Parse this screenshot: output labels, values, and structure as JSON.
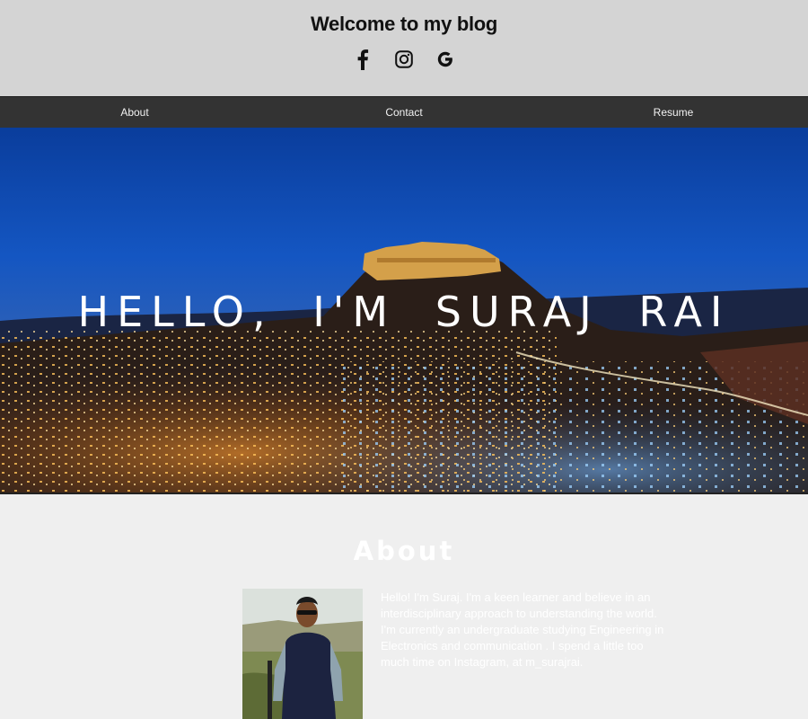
{
  "header": {
    "title": "Welcome to my blog",
    "social": [
      {
        "name": "facebook",
        "icon": "facebook-icon"
      },
      {
        "name": "instagram",
        "icon": "instagram-icon"
      },
      {
        "name": "google",
        "icon": "google-icon"
      }
    ]
  },
  "nav": {
    "items": [
      {
        "label": "About"
      },
      {
        "label": "Contact"
      },
      {
        "label": "Resume"
      }
    ]
  },
  "hero": {
    "title": "HELLO, I'M SURAJ RAI",
    "image": "night-city-fort-photo"
  },
  "about": {
    "heading": "About",
    "avatar": "profile-photo",
    "text": "Hello! I'm Suraj. I'm a keen learner and believe in an interdisciplinary approach to understanding the world. I'm currently an undergraduate studying Engineering in Electronics and communication . I spend a little too much time on Instagram, at m_surajrai."
  },
  "colors": {
    "header_bg": "#d4d4d4",
    "nav_bg": "#333333",
    "page_bg": "#efefef",
    "text_light": "#ffffff"
  }
}
